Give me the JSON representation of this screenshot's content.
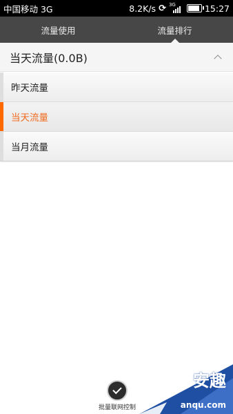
{
  "status_bar": {
    "carrier": "中国移动 3G",
    "speed": "8.2K/s",
    "network_tag": "3G",
    "time": "15:27",
    "battery_level": 0.8
  },
  "tabs": [
    {
      "label": "流量使用",
      "active": false
    },
    {
      "label": "流量排行",
      "active": true
    }
  ],
  "section": {
    "title": "当天流量(0.0B)"
  },
  "menu_items": [
    {
      "label": "昨天流量",
      "selected": false
    },
    {
      "label": "当天流量",
      "selected": true
    },
    {
      "label": "当月流量",
      "selected": false
    }
  ],
  "bottom_action": {
    "label": "批量联网控制"
  },
  "watermark": {
    "main": "安趣",
    "domain": "anqu.com"
  },
  "colors": {
    "accent": "#ff6a00",
    "tab_bg": "#474747",
    "watermark_blue": "#1f4fa3"
  }
}
